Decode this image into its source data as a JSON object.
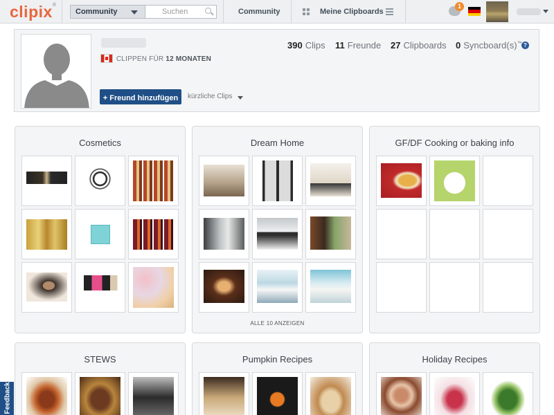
{
  "topbar": {
    "logo": "clipix",
    "logo_mark": "®",
    "scope_select": "Community",
    "search_placeholder": "Suchen",
    "community_link": "Community",
    "my_clipboards_link": "Meine Clipboards",
    "notification_count": "1"
  },
  "profile": {
    "clip_months_prefix": "CLIPPEN FÜR",
    "clip_months_value": "12 MONATEN",
    "add_friend_button": "+ Freund hinzufügen",
    "recent_clips_label": "kürzliche Clips",
    "stats": {
      "clips_count": "390",
      "clips_label": "Clips",
      "friends_count": "11",
      "friends_label": "Freunde",
      "clipboards_count": "27",
      "clipboards_label": "Clipboards",
      "syncboards_count": "0",
      "syncboards_label": "Syncboard(s)",
      "syncboards_mark": "™"
    },
    "help_icon": "?"
  },
  "clipboards": [
    {
      "title": "Cosmetics"
    },
    {
      "title": "Dream Home",
      "show_all": "ALLE 10 ANZEIGEN"
    },
    {
      "title": "GF/DF Cooking or baking info"
    },
    {
      "title": "STEWS"
    },
    {
      "title": "Pumpkin Recipes"
    },
    {
      "title": "Holiday Recipes"
    }
  ],
  "feedback_tab": "Feedback",
  "colors": {
    "brand_orange": "#e8663d",
    "primary_button": "#1f4f86",
    "notification_badge": "#f08a2a"
  }
}
